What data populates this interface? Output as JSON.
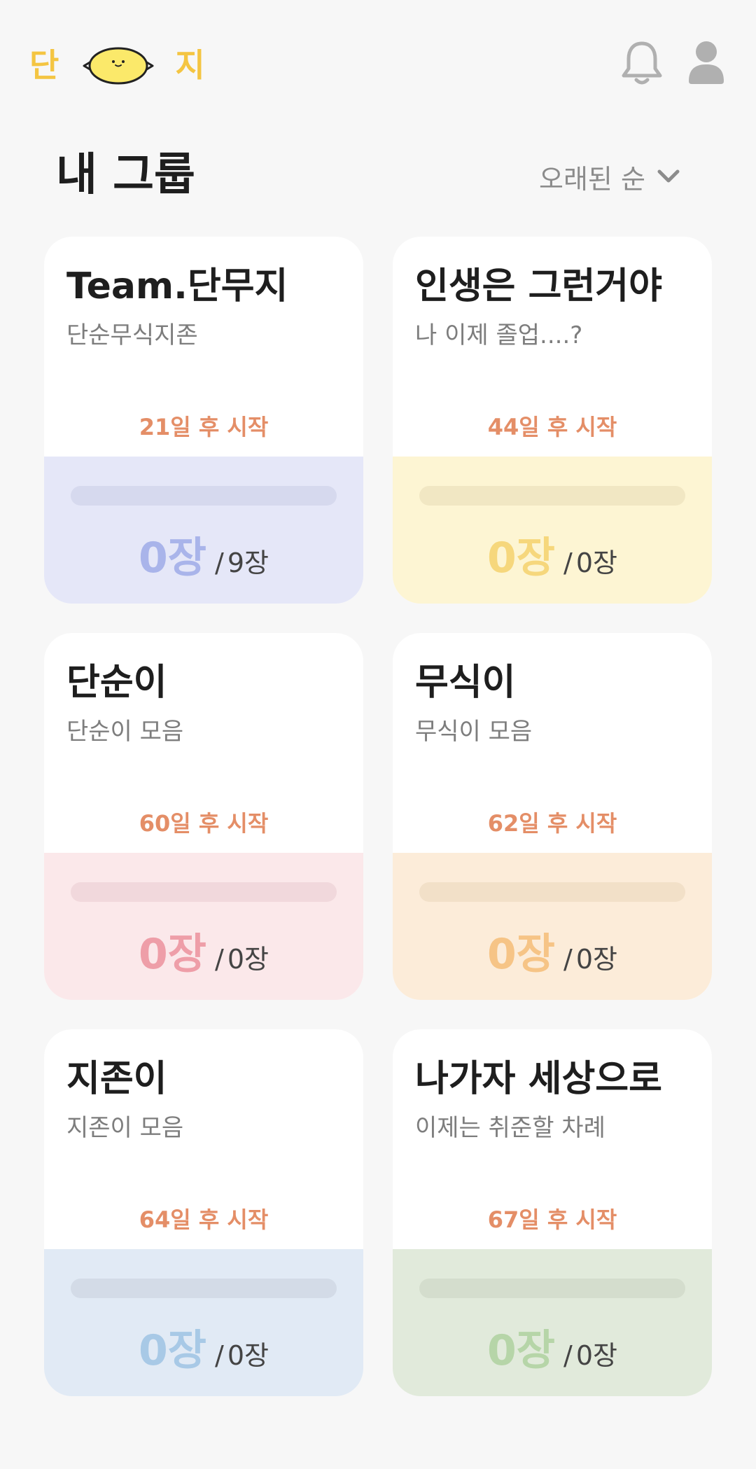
{
  "header": {
    "logo_left": "단",
    "logo_right": "지",
    "icons": [
      "lemon-logo-icon",
      "bell-icon",
      "user-icon"
    ]
  },
  "page": {
    "title": "내 그룹",
    "sort_label": "오래된 순"
  },
  "groups": [
    {
      "title": "Team.단무지",
      "subtitle": "단순무식지존",
      "start": "21일 후 시작",
      "current": "0장",
      "separator": "/",
      "total": "9장",
      "theme": {
        "bg": "#e5e7f8",
        "bar": "#d6d9ee",
        "accent": "#a9b4ea"
      }
    },
    {
      "title": "인생은 그런거야",
      "subtitle": "나 이제 졸업....?",
      "start": "44일 후 시작",
      "current": "0장",
      "separator": "/",
      "total": "0장",
      "theme": {
        "bg": "#fdf5d3",
        "bar": "#f1e7c3",
        "accent": "#f6d77c"
      }
    },
    {
      "title": "단순이",
      "subtitle": "단순이 모음",
      "start": "60일 후 시작",
      "current": "0장",
      "separator": "/",
      "total": "0장",
      "theme": {
        "bg": "#fbe8ea",
        "bar": "#f1d8dc",
        "accent": "#ee9ea8"
      }
    },
    {
      "title": "무식이",
      "subtitle": "무식이 모음",
      "start": "62일 후 시작",
      "current": "0장",
      "separator": "/",
      "total": "0장",
      "theme": {
        "bg": "#fcecd9",
        "bar": "#f2e0c8",
        "accent": "#f6c486"
      }
    },
    {
      "title": "지존이",
      "subtitle": "지존이 모음",
      "start": "64일 후 시작",
      "current": "0장",
      "separator": "/",
      "total": "0장",
      "theme": {
        "bg": "#e1eaf5",
        "bar": "#d3dbe7",
        "accent": "#a8c9e6"
      }
    },
    {
      "title": "나가자 세상으로",
      "subtitle": "이제는 취준할 차례",
      "start": "67일 후 시작",
      "current": "0장",
      "separator": "/",
      "total": "0장",
      "theme": {
        "bg": "#e1eadb",
        "bar": "#d4ddcd",
        "accent": "#b6d5a8"
      }
    }
  ]
}
